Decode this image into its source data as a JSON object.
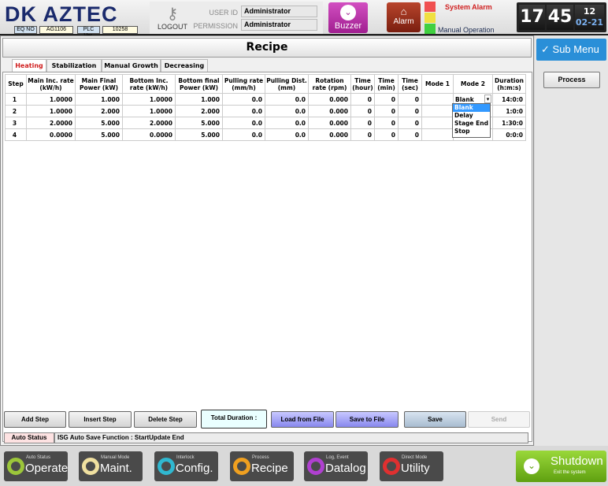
{
  "header": {
    "logo": "DK AZTEC",
    "eq_no_label": "EQ NO",
    "eq_no": "AG1106",
    "plc_label": "PLC Ver.",
    "plc_ver": "10258",
    "logout": "LOGOUT",
    "user_id_label": "USER ID",
    "user_id": "Administrator",
    "permission_label": "PERMISSION",
    "permission": "Administrator",
    "buzzer": "Buzzer",
    "alarm": "Alarm",
    "system_alarm": "System Alarm",
    "manual_operation": "Manual Operation",
    "clock": {
      "hour": "17",
      "minute": "45",
      "day": "12",
      "date": "02-21"
    }
  },
  "colors": {
    "lamp_red": "#f05050",
    "lamp_yellow": "#f0e040",
    "lamp_green": "#40d040",
    "submenu": "#2a8fd8",
    "shutdown": "#7cc020"
  },
  "main": {
    "title": "Recipe",
    "tabs": [
      {
        "label": "Heating",
        "active": true
      },
      {
        "label": "Stabilization"
      },
      {
        "label": "Manual Growth"
      },
      {
        "label": "Decreasing"
      }
    ],
    "columns": [
      "Step",
      "Main Inc. rate (kW/h)",
      "Main Final Power (kW)",
      "Bottom Inc. rate (kW/h)",
      "Bottom final Power (kW)",
      "Pulling rate (mm/h)",
      "Pulling Dist. (mm)",
      "Rotation rate (rpm)",
      "Time (hour)",
      "Time (min)",
      "Time (sec)",
      "Mode 1",
      "Mode 2",
      "Duration (h:m:s)"
    ],
    "rows": [
      [
        "1",
        "1.0000",
        "1.000",
        "1.0000",
        "1.000",
        "0.0",
        "0.0",
        "0.000",
        "0",
        "0",
        "0",
        "",
        "Blank",
        "14:0:0"
      ],
      [
        "2",
        "1.0000",
        "2.000",
        "1.0000",
        "2.000",
        "0.0",
        "0.0",
        "0.000",
        "0",
        "0",
        "0",
        "",
        "",
        "1:0:0"
      ],
      [
        "3",
        "2.0000",
        "5.000",
        "2.0000",
        "5.000",
        "0.0",
        "0.0",
        "0.000",
        "0",
        "0",
        "0",
        "",
        "",
        "1:30:0"
      ],
      [
        "4",
        "0.0000",
        "5.000",
        "0.0000",
        "5.000",
        "0.0",
        "0.0",
        "0.000",
        "0",
        "0",
        "0",
        "",
        "",
        "0:0:0"
      ]
    ],
    "mode2_options": [
      "Blank",
      "Delay",
      "Stage End",
      "Stop"
    ],
    "buttons": {
      "add": "Add Step",
      "insert": "Insert Step",
      "delete": "Delete Step",
      "total": "Total Duration :",
      "load": "Load from File",
      "save_file": "Save to File",
      "save": "Save",
      "send": "Send"
    },
    "status": {
      "label": "Auto Status",
      "text": "ISG Auto Save Function : StartUpdate End"
    }
  },
  "side": {
    "submenu": "Sub Menu",
    "process": "Process"
  },
  "nav": [
    {
      "sub": "Auto Status",
      "label": "Operate",
      "color": "#9cc63a"
    },
    {
      "sub": "Manual Mode",
      "label": "Maint.",
      "color": "#f0e0a0"
    },
    {
      "sub": "Interlock",
      "label": "Config.",
      "color": "#30b8d0"
    },
    {
      "sub": "Process",
      "label": "Recipe",
      "color": "#f0a020"
    },
    {
      "sub": "Log, Event",
      "label": "Datalog",
      "color": "#b040d0"
    },
    {
      "sub": "Direct Mode",
      "label": "Utility",
      "color": "#e03030"
    }
  ],
  "shutdown": {
    "label": "Shutdown",
    "sub": "Exit the system"
  }
}
